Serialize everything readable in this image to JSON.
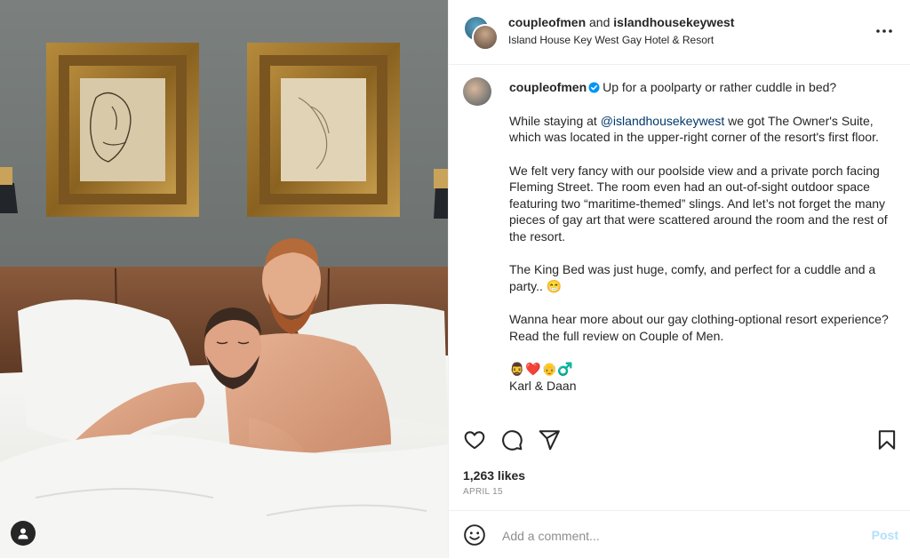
{
  "header": {
    "user1": "coupleofmen",
    "and_text": "and",
    "user2": "islandhousekeywest",
    "location": "Island House Key West Gay Hotel & Resort"
  },
  "caption": {
    "username": "coupleofmen",
    "first_line": "Up for a poolparty or rather cuddle in bed?",
    "p2_before": "While staying at ",
    "p2_mention": "@islandhousekeywest",
    "p2_after": " we got The Owner's Suite, which was located in the upper-right corner of the resort's first floor.",
    "p3": "We felt very fancy with our poolside view and a private porch facing Fleming Street. The room even had an out-of-sight outdoor space featuring two “maritime-themed” slings. And let’s not forget the many pieces of gay art that were scattered around the room and the rest of the resort.",
    "p4": "The King Bed was just huge, comfy, and perfect for a cuddle and a party.. 😁",
    "p5": "Wanna hear more about our gay clothing-optional resort experience? Read the full review on Couple of Men.",
    "emoji_line": "🧔‍♂️❤️👴‍♂️",
    "signoff": "Karl & Daan"
  },
  "stats": {
    "likes": "1,263 likes",
    "date": "APRIL 15"
  },
  "comment": {
    "placeholder": "Add a comment...",
    "post_label": "Post"
  },
  "colors": {
    "mention": "#00376b",
    "verified": "#0095f6",
    "post_disabled": "#b2dffc",
    "muted": "#8e8e8e"
  },
  "icons": [
    "user-tag-icon",
    "more-options-icon",
    "verified-badge-icon",
    "heart-icon",
    "comment-icon",
    "share-icon",
    "bookmark-icon",
    "emoji-icon"
  ]
}
